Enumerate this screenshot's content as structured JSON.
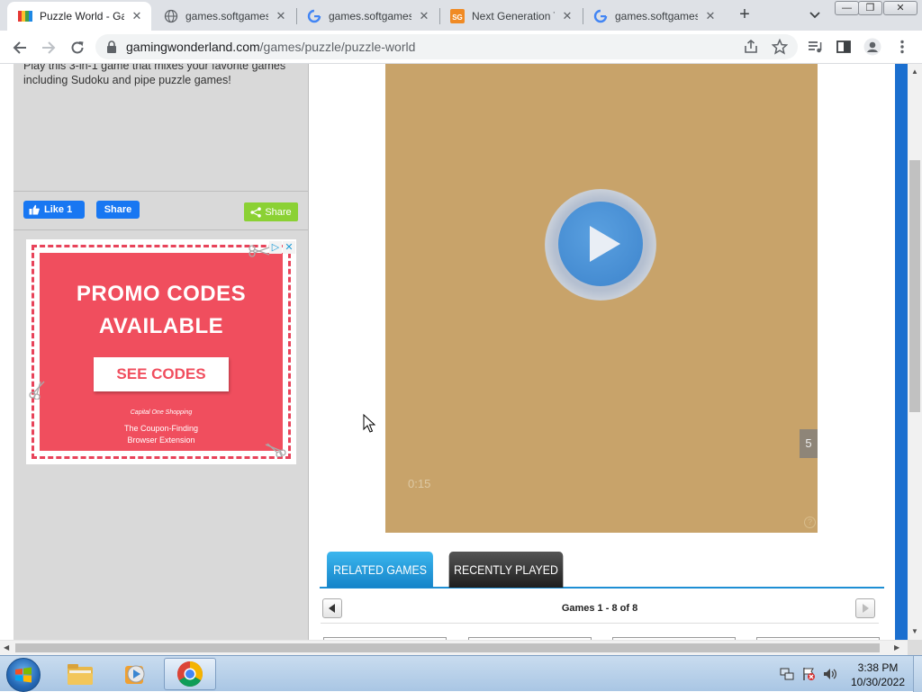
{
  "browser": {
    "tabs": [
      {
        "title": "Puzzle World - Ga",
        "active": true
      },
      {
        "title": "games.softgames",
        "active": false
      },
      {
        "title": "games.softgames",
        "active": false
      },
      {
        "title": "Next Generation T",
        "active": false
      },
      {
        "title": "games.softgames",
        "active": false
      }
    ],
    "url_host": "gamingwonderland.com",
    "url_path": "/games/puzzle/puzzle-world",
    "window_controls": {
      "minimize": "—",
      "restore": "❐",
      "close": "✕"
    }
  },
  "page": {
    "description": "Play this 3-in-1 game that mixes your favorite games including Sudoku and pipe puzzle games!",
    "social": {
      "like_label": "Like 1",
      "fb_share_label": "Share",
      "share_label": "Share"
    },
    "ad": {
      "headline_line1": "PROMO CODES",
      "headline_line2": "AVAILABLE",
      "button": "SEE CODES",
      "brand": "Capital One Shopping",
      "tagline_line1": "The Coupon-Finding",
      "tagline_line2": "Browser Extension",
      "accent_color": "#f04e5e"
    },
    "video": {
      "time": "0:15",
      "countdown": "5",
      "help": "?"
    },
    "game_tabs": {
      "related": "RELATED GAMES",
      "recent": "RECENTLY PLAYED"
    },
    "pager_label": "Games 1 - 8 of 8"
  },
  "taskbar": {
    "time": "3:38 PM",
    "date": "10/30/2022"
  }
}
